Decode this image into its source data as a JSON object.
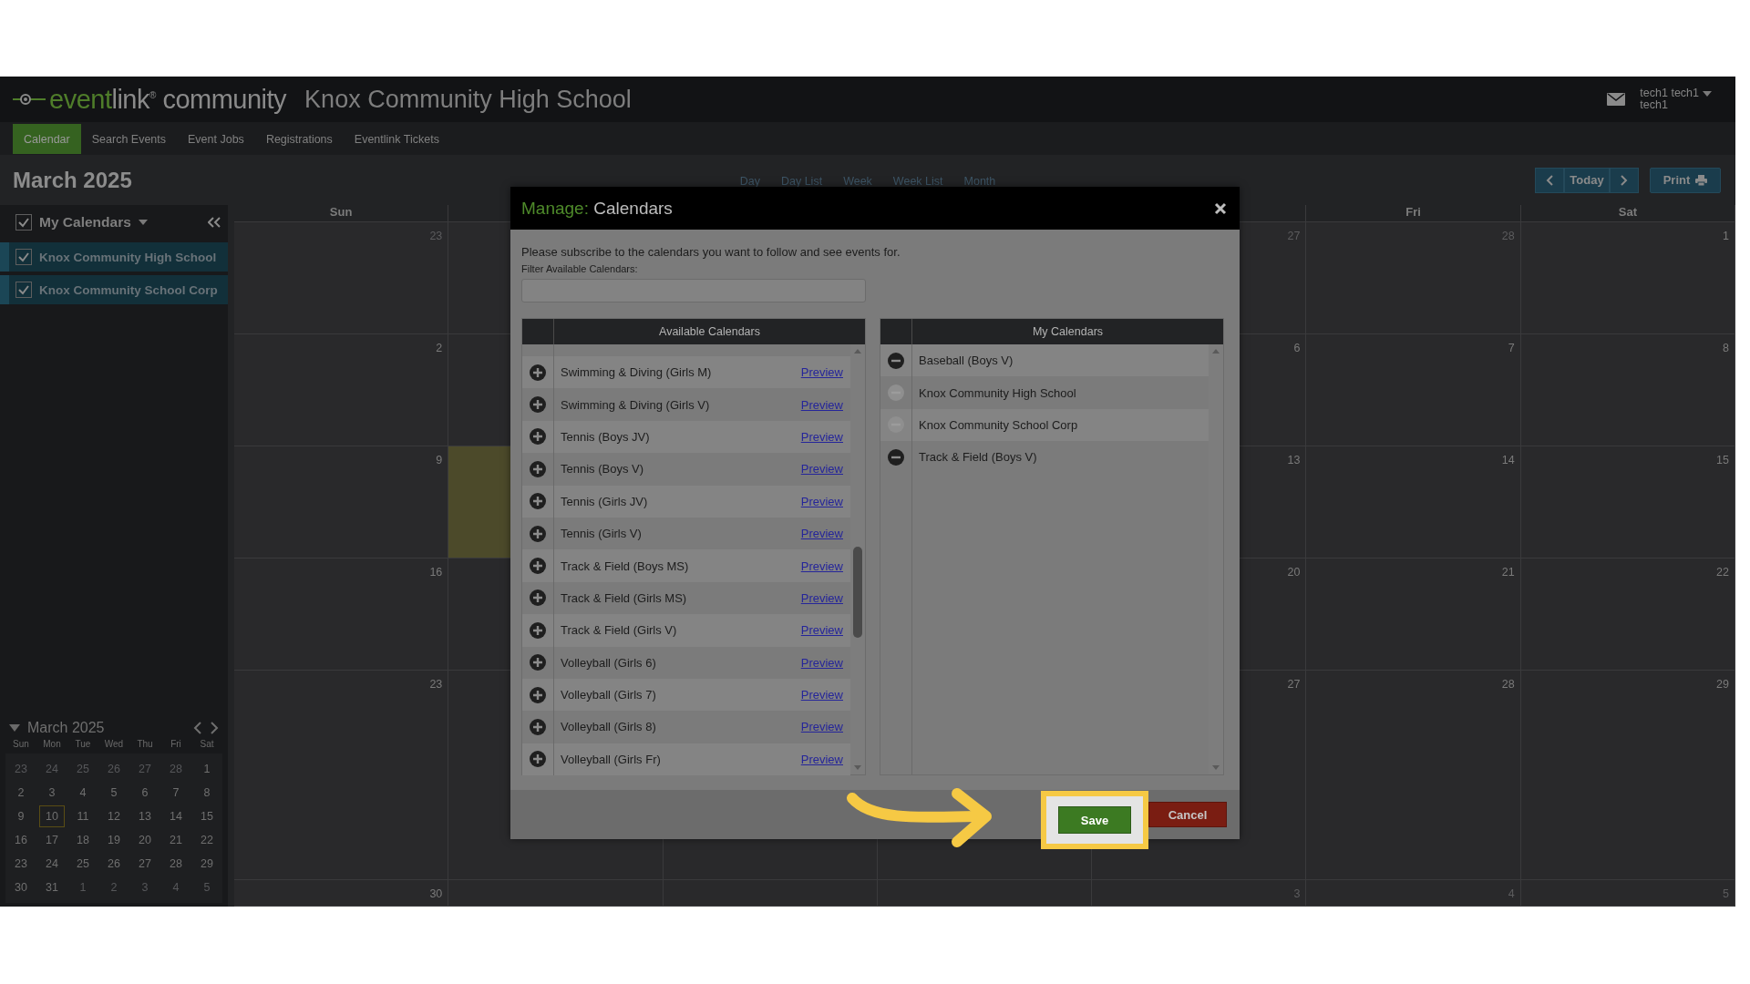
{
  "header": {
    "logo": {
      "brand_first": "event",
      "brand_second": "link",
      "mark": "®",
      "product": "community"
    },
    "school": "Knox Community High School",
    "user": {
      "name": "tech1 tech1",
      "login": "tech1"
    }
  },
  "nav": [
    {
      "label": "Calendar",
      "selected": true
    },
    {
      "label": "Search Events",
      "selected": false
    },
    {
      "label": "Event Jobs",
      "selected": false
    },
    {
      "label": "Registrations",
      "selected": false
    },
    {
      "label": "Eventlink Tickets",
      "selected": false
    }
  ],
  "toolbar": {
    "title": "March 2025",
    "views": [
      "Day",
      "Day List",
      "Week",
      "Week List",
      "Month"
    ],
    "today": "Today",
    "print": "Print"
  },
  "sidebar": {
    "header": {
      "label": "My Calendars",
      "checked": true
    },
    "calendars": [
      {
        "label": "Knox Community High School",
        "checked": true
      },
      {
        "label": "Knox Community School Corp",
        "checked": true
      }
    ],
    "mini_calendar": {
      "title": "March 2025",
      "weekdays": [
        "Sun",
        "Mon",
        "Tue",
        "Wed",
        "Thu",
        "Fri",
        "Sat"
      ],
      "weeks": [
        [
          {
            "day": "23",
            "muted": true,
            "today": false
          },
          {
            "day": "24",
            "muted": true,
            "today": false
          },
          {
            "day": "25",
            "muted": true,
            "today": false
          },
          {
            "day": "26",
            "muted": true,
            "today": false
          },
          {
            "day": "27",
            "muted": true,
            "today": false
          },
          {
            "day": "28",
            "muted": true,
            "today": false
          },
          {
            "day": "1",
            "muted": false,
            "today": false
          }
        ],
        [
          {
            "day": "2",
            "muted": false,
            "today": false
          },
          {
            "day": "3",
            "muted": false,
            "today": false
          },
          {
            "day": "4",
            "muted": false,
            "today": false
          },
          {
            "day": "5",
            "muted": false,
            "today": false
          },
          {
            "day": "6",
            "muted": false,
            "today": false
          },
          {
            "day": "7",
            "muted": false,
            "today": false
          },
          {
            "day": "8",
            "muted": false,
            "today": false
          }
        ],
        [
          {
            "day": "9",
            "muted": false,
            "today": false
          },
          {
            "day": "10",
            "muted": false,
            "today": true
          },
          {
            "day": "11",
            "muted": false,
            "today": false
          },
          {
            "day": "12",
            "muted": false,
            "today": false
          },
          {
            "day": "13",
            "muted": false,
            "today": false
          },
          {
            "day": "14",
            "muted": false,
            "today": false
          },
          {
            "day": "15",
            "muted": false,
            "today": false
          }
        ],
        [
          {
            "day": "16",
            "muted": false,
            "today": false
          },
          {
            "day": "17",
            "muted": false,
            "today": false
          },
          {
            "day": "18",
            "muted": false,
            "today": false
          },
          {
            "day": "19",
            "muted": false,
            "today": false
          },
          {
            "day": "20",
            "muted": false,
            "today": false
          },
          {
            "day": "21",
            "muted": false,
            "today": false
          },
          {
            "day": "22",
            "muted": false,
            "today": false
          }
        ],
        [
          {
            "day": "23",
            "muted": false,
            "today": false
          },
          {
            "day": "24",
            "muted": false,
            "today": false
          },
          {
            "day": "25",
            "muted": false,
            "today": false
          },
          {
            "day": "26",
            "muted": false,
            "today": false
          },
          {
            "day": "27",
            "muted": false,
            "today": false
          },
          {
            "day": "28",
            "muted": false,
            "today": false
          },
          {
            "day": "29",
            "muted": false,
            "today": false
          }
        ],
        [
          {
            "day": "30",
            "muted": false,
            "today": false
          },
          {
            "day": "31",
            "muted": false,
            "today": false
          },
          {
            "day": "1",
            "muted": true,
            "today": false
          },
          {
            "day": "2",
            "muted": true,
            "today": false
          },
          {
            "day": "3",
            "muted": true,
            "today": false
          },
          {
            "day": "4",
            "muted": true,
            "today": false
          },
          {
            "day": "5",
            "muted": true,
            "today": false
          }
        ]
      ]
    }
  },
  "calendar": {
    "weekdays": {
      "left": [
        "Sun"
      ],
      "right": [
        "Fri",
        "Sat"
      ]
    },
    "weeks": [
      {
        "left": [
          {
            "day": "23",
            "muted": true,
            "today": false
          },
          {
            "today": false
          }
        ],
        "right": [
          {
            "day": "27",
            "muted": true,
            "today": false
          },
          {
            "day": "28",
            "muted": true,
            "today": false
          },
          {
            "day": "1",
            "muted": false,
            "today": false
          }
        ]
      },
      {
        "left": [
          {
            "day": "2",
            "muted": false,
            "today": false
          },
          {
            "today": false
          }
        ],
        "right": [
          {
            "day": "6",
            "muted": false,
            "today": false
          },
          {
            "day": "7",
            "muted": false,
            "today": false
          },
          {
            "day": "8",
            "muted": false,
            "today": false
          }
        ]
      },
      {
        "left": [
          {
            "day": "9",
            "muted": false,
            "today": false
          },
          {
            "today": true
          }
        ],
        "right": [
          {
            "day": "13",
            "muted": false,
            "today": false
          },
          {
            "day": "14",
            "muted": false,
            "today": false
          },
          {
            "day": "15",
            "muted": false,
            "today": false
          }
        ]
      },
      {
        "left": [
          {
            "day": "16",
            "muted": false,
            "today": false
          },
          {
            "today": false
          }
        ],
        "right": [
          {
            "day": "20",
            "muted": false,
            "today": false
          },
          {
            "day": "21",
            "muted": false,
            "today": false
          },
          {
            "day": "22",
            "muted": false,
            "today": false
          }
        ]
      },
      {
        "left": [
          {
            "day": "23",
            "muted": false,
            "today": false
          },
          {
            "today": false
          }
        ],
        "right": [
          {
            "day": "27",
            "muted": false,
            "today": false
          },
          {
            "day": "28",
            "muted": false,
            "today": false
          },
          {
            "day": "29",
            "muted": false,
            "today": false
          }
        ]
      },
      {
        "left": [
          {
            "day": "30",
            "muted": false,
            "today": false
          },
          {
            "today": false
          }
        ],
        "right": [
          {
            "day": "3",
            "muted": true,
            "today": false
          },
          {
            "day": "4",
            "muted": true,
            "today": false
          },
          {
            "day": "5",
            "muted": true,
            "today": false
          }
        ]
      }
    ]
  },
  "modal": {
    "title_prefix": "Manage:",
    "title": "Calendars",
    "intro": "Please subscribe to the calendars you want to follow and see events for.",
    "filter_label": "Filter Available Calendars:",
    "available": {
      "heading": "Available Calendars",
      "items": [
        {
          "name": "Swimming & Diving (Girls M)",
          "link": "Preview"
        },
        {
          "name": "Swimming & Diving (Girls V)",
          "link": "Preview"
        },
        {
          "name": "Tennis (Boys JV)",
          "link": "Preview"
        },
        {
          "name": "Tennis (Boys V)",
          "link": "Preview"
        },
        {
          "name": "Tennis (Girls JV)",
          "link": "Preview"
        },
        {
          "name": "Tennis (Girls V)",
          "link": "Preview"
        },
        {
          "name": "Track & Field (Boys MS)",
          "link": "Preview"
        },
        {
          "name": "Track & Field (Girls MS)",
          "link": "Preview"
        },
        {
          "name": "Track & Field (Girls V)",
          "link": "Preview"
        },
        {
          "name": "Volleyball (Girls 6)",
          "link": "Preview"
        },
        {
          "name": "Volleyball (Girls 7)",
          "link": "Preview"
        },
        {
          "name": "Volleyball (Girls 8)",
          "link": "Preview"
        },
        {
          "name": "Volleyball (Girls Fr)",
          "link": "Preview"
        }
      ]
    },
    "mine": {
      "heading": "My Calendars",
      "items": [
        {
          "name": "Baseball (Boys V)",
          "disabled": false
        },
        {
          "name": "Knox Community High School",
          "disabled": true
        },
        {
          "name": "Knox Community School Corp",
          "disabled": true
        },
        {
          "name": "Track & Field (Boys V)",
          "disabled": false
        }
      ]
    },
    "buttons": [
      {
        "label": "Save",
        "kind": "save",
        "highlighted": true
      },
      {
        "label": "Cancel",
        "kind": "cancel",
        "highlighted": false
      }
    ]
  }
}
